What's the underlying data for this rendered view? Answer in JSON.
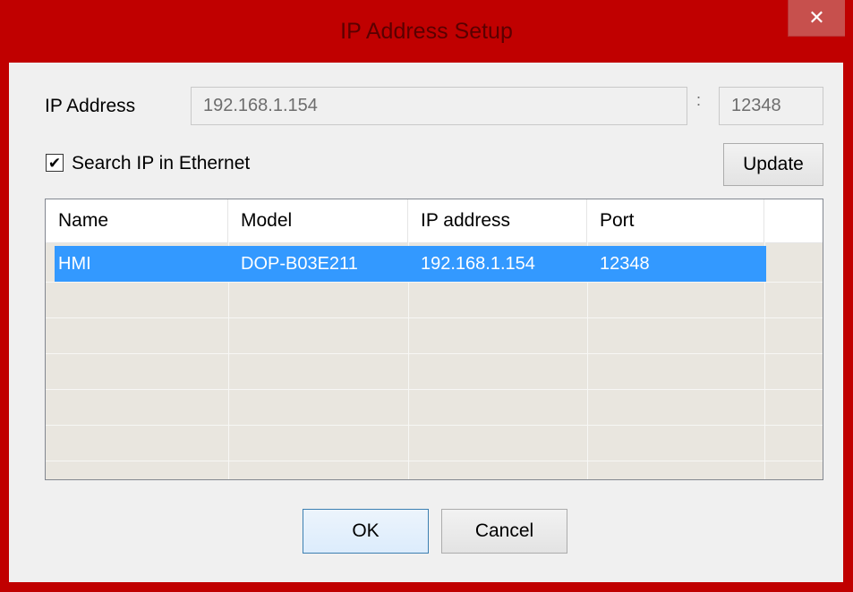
{
  "window": {
    "title": "IP Address Setup",
    "close_glyph": "✕"
  },
  "form": {
    "ip_label": "IP Address",
    "ip_value": "192.168.1.154",
    "port_separator": ":",
    "port_value": "12348",
    "search_label": "Search IP in Ethernet",
    "search_checked": true,
    "check_glyph": "✔",
    "update_label": "Update"
  },
  "table": {
    "columns": [
      "Name",
      "Model",
      "IP address",
      "Port"
    ],
    "rows": [
      {
        "name": "HMI",
        "model": "DOP-B03E211",
        "ip": "192.168.1.154",
        "port": "12348",
        "selected": true
      }
    ]
  },
  "buttons": {
    "ok": "OK",
    "cancel": "Cancel"
  },
  "colors": {
    "frame": "#c00000",
    "selection": "#3399ff",
    "list_bg": "#e9e6df"
  }
}
